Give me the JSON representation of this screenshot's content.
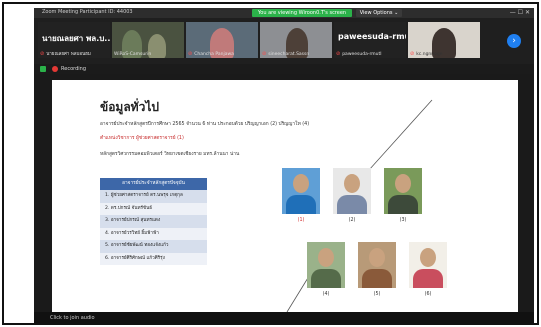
{
  "window": {
    "title": "Zoom Meeting Participant ID: 44003",
    "sharing_banner": "You are viewing Wiroon0.T's screen",
    "view_options": "View Options ⌄"
  },
  "participants": [
    {
      "big_name": "นายณลยศา พล.บ...",
      "label": "นายณลยศา พลบอนฮม"
    },
    {
      "big_name": "",
      "label": "WiRoS-Camsurin"
    },
    {
      "big_name": "",
      "label": "Chancha Panjawa"
    },
    {
      "big_name": "",
      "label": "sineecharat.Sassn"
    },
    {
      "big_name": "paweesuda-rmutl",
      "label": "paweesuda-rmutl"
    },
    {
      "big_name": "",
      "label": "kc.ngnnoge"
    }
  ],
  "recording": {
    "label": "Recording"
  },
  "slide": {
    "title": "ข้อมูลทั่วไป",
    "line1": "อาจารย์ประจำหลักสูตรปีการศึกษา 2565 จำนวน 6 ท่าน ประกอบด้วย ปริญญาเอก (2) ปริญญาโท (4)",
    "line2": "ตำแหน่งวิชาการ ผู้ช่วยศาสตราจารย์ (1)",
    "line3": "หลักสูตรวิศวกรรมคอมพิวเตอร์ วิทยาเขตเชียงราย มทร.ล้านนา น่าน",
    "table_header": "อาจารย์ประจำหลักสูตรปัจจุบัน",
    "staff": [
      "1. ผู้ช่วยศาสตราจารย์ ดร.นพรุจ เกตุกุล",
      "2. ดร.ปกรณ์  จันทร์ขันธ์",
      "3. อาจารย์ปกรณ์ สุนทรแดง",
      "4. อาจารย์วรวิทย์ ยิ้มฟ้าฟ้า",
      "5. อาจารย์ชัยพัฒน์ ทองแจ้งแก้ว",
      "6. อาจารย์ศิริศักษณ์ แก้วศิริรุ่ง"
    ],
    "photo_captions": [
      "(1)",
      "(2)",
      "(3)",
      "(4)",
      "(5)",
      "(6)"
    ]
  },
  "footer": {
    "join_audio": "Click to join audio"
  }
}
